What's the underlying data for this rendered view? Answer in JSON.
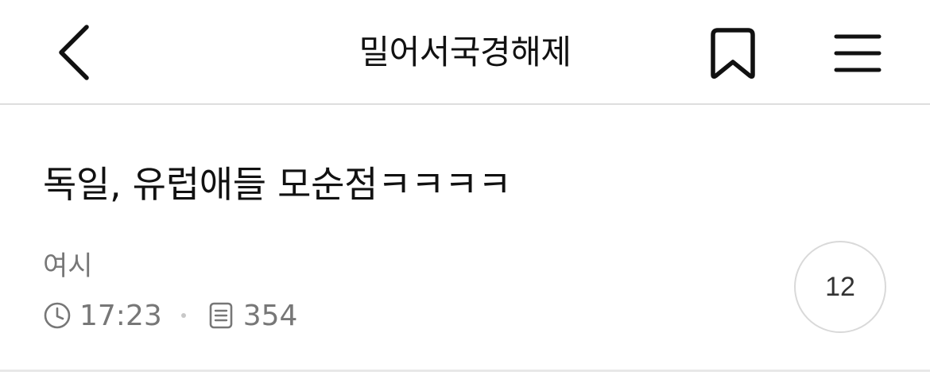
{
  "header": {
    "title": "밀어서국경해제",
    "back_icon": "chevron-left-icon",
    "bookmark_icon": "bookmark-icon",
    "menu_icon": "hamburger-menu-icon"
  },
  "post": {
    "title": "독일, 유럽애들 모순점ㅋㅋㅋㅋ",
    "author": "여시",
    "time": "17:23",
    "views": "354",
    "comment_count": "12"
  },
  "colors": {
    "text_primary": "#111111",
    "text_secondary": "#777777",
    "divider": "#dedede"
  }
}
